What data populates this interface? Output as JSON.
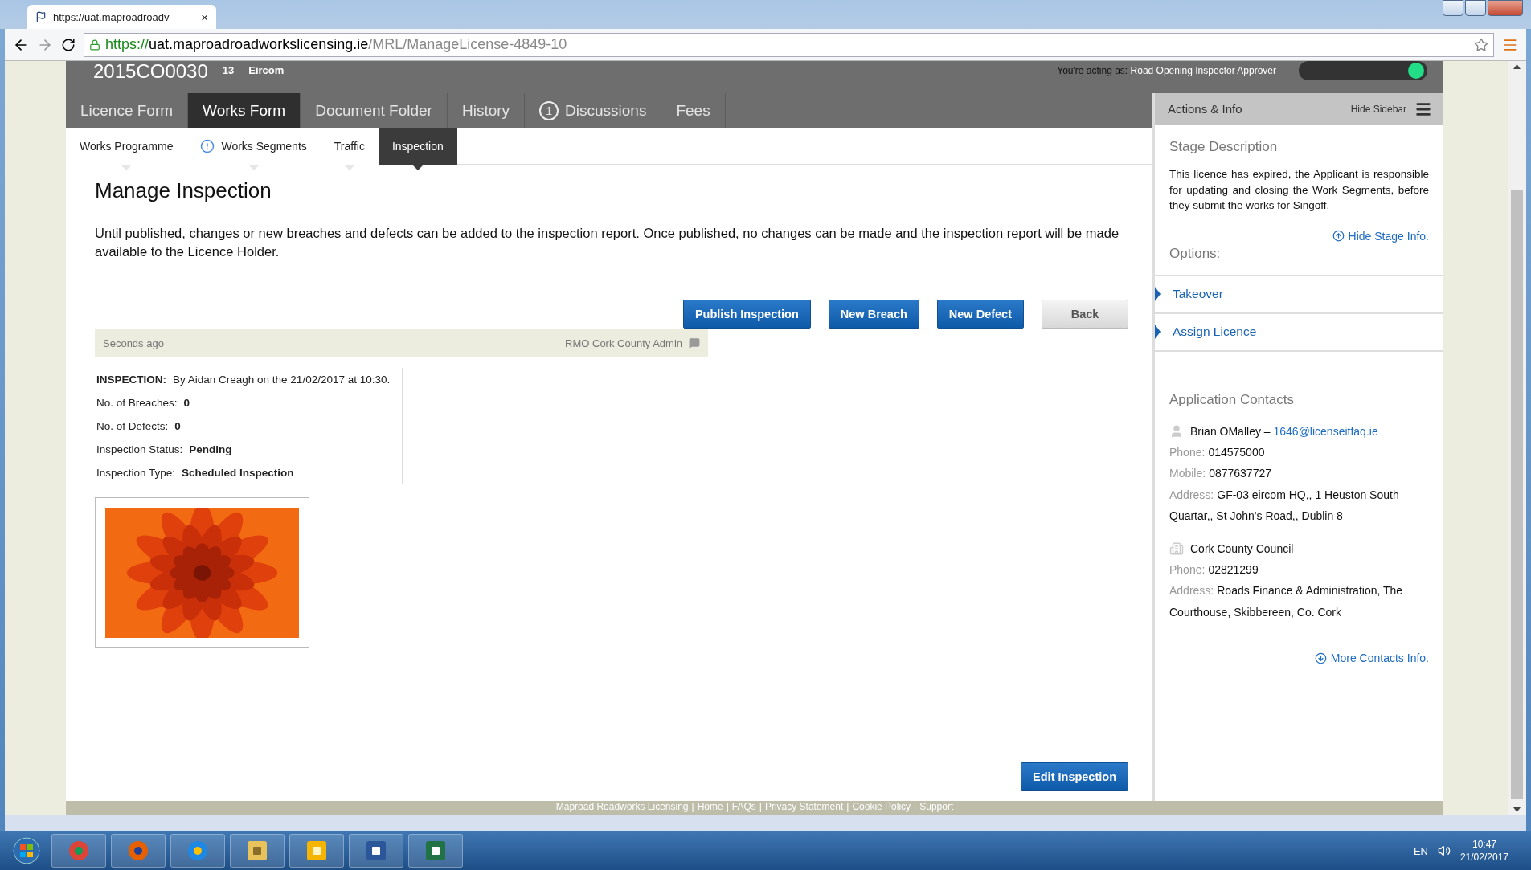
{
  "browser": {
    "tab_title": "https://uat.maproadroadv",
    "tab_close": "×",
    "url_secure": "https://",
    "url_host": "uat.maproadroadworkslicensing.ie",
    "url_path": "/MRL/ManageLicense-4849-10"
  },
  "header": {
    "licence_ref": "2015CO0030",
    "licence_num": "13",
    "company": "Eircom",
    "acting_label": "You're acting as:",
    "acting_role": "Road Opening Inspector Approver",
    "role_toggle": {
      "on": true
    }
  },
  "main_tabs": [
    {
      "label": "Licence Form",
      "selected": false
    },
    {
      "label": "Works Form",
      "selected": true
    },
    {
      "label": "Document Folder",
      "selected": false
    },
    {
      "label": "History",
      "selected": false
    },
    {
      "label": "Discussions",
      "badge": "1",
      "selected": false
    },
    {
      "label": "Fees",
      "selected": false
    }
  ],
  "sub_tabs": [
    {
      "label": "Works Programme",
      "alert": false,
      "selected": false
    },
    {
      "label": "Works Segments",
      "alert": true,
      "selected": false
    },
    {
      "label": "Traffic",
      "alert": false,
      "selected": false
    },
    {
      "label": "Inspection",
      "alert": false,
      "selected": true
    }
  ],
  "page": {
    "title": "Manage Inspection",
    "intro": "Until published, changes or new breaches and defects can be added to the inspection report. Once published, no changes can be made and the inspection report will be made available to the Licence Holder.",
    "actions": [
      {
        "label": "Publish Inspection",
        "kind": "primary"
      },
      {
        "label": "New Breach",
        "kind": "primary"
      },
      {
        "label": "New Defect",
        "kind": "primary"
      },
      {
        "label": "Back",
        "kind": "secondary"
      }
    ],
    "entry": {
      "time": "Seconds ago",
      "author": "RMO Cork County Admin"
    },
    "details": [
      {
        "label": "INSPECTION:",
        "value": "By Aidan Creagh on the 21/02/2017 at 10:30."
      },
      {
        "label": "No. of Breaches:",
        "value": "0"
      },
      {
        "label": "No. of Defects:",
        "value": "0"
      },
      {
        "label": "Inspection Status:",
        "value": "Pending"
      },
      {
        "label": "Inspection Type:",
        "value": "Scheduled Inspection"
      }
    ],
    "edit_button": "Edit Inspection"
  },
  "sidebar": {
    "title": "Actions & Info",
    "hide_label": "Hide Sidebar",
    "stage_heading": "Stage Description",
    "stage_text": "This licence has expired, the Applicant is responsible for updating and closing the Work Segments, before they submit the works for Singoff.",
    "hide_stage": "Hide Stage Info.",
    "options_heading": "Options:",
    "options": [
      "Takeover",
      "Assign Licence"
    ],
    "contacts_heading": "Application Contacts",
    "contacts": [
      {
        "kind": "person",
        "name": "Brian OMalley",
        "separator": "–",
        "email": "1646@licenseitfaq.ie",
        "fields": [
          {
            "label": "Phone:",
            "value": "014575000"
          },
          {
            "label": "Mobile:",
            "value": "0877637727"
          },
          {
            "label": "Address:",
            "value": "GF-03 eircom HQ,, 1 Heuston South Quartar,, St John's Road,, Dublin 8"
          }
        ]
      },
      {
        "kind": "organisation",
        "name": "Cork County Council",
        "fields": [
          {
            "label": "Phone:",
            "value": "02821299"
          },
          {
            "label": "Address:",
            "value": "Roads Finance & Administration, The Courthouse, Skibbereen, Co. Cork"
          }
        ]
      }
    ],
    "more_contacts": "More Contacts Info."
  },
  "footer": {
    "separator": "|",
    "links": [
      "Maproad Roadworks Licensing",
      "Home",
      "FAQs",
      "Privacy Statement",
      "Cookie Policy",
      "Support"
    ]
  },
  "taskbar": {
    "language": "EN",
    "time": "10:47",
    "date": "21/02/2017"
  }
}
